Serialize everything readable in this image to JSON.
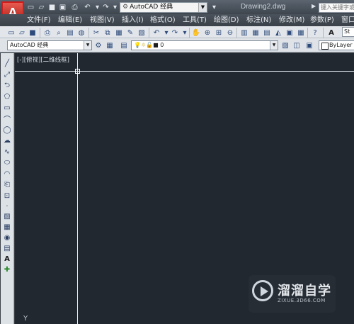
{
  "app": {
    "logo_letter": "A"
  },
  "title_bar": {
    "workspace": "AutoCAD 经典",
    "document_title": "Drawing2.dwg",
    "search_placeholder": "键入关键字或短语"
  },
  "menu": [
    {
      "label": "文件(F)"
    },
    {
      "label": "编辑(E)"
    },
    {
      "label": "视图(V)"
    },
    {
      "label": "插入(I)"
    },
    {
      "label": "格式(O)"
    },
    {
      "label": "工具(T)"
    },
    {
      "label": "绘图(D)"
    },
    {
      "label": "标注(N)"
    },
    {
      "label": "修改(M)"
    },
    {
      "label": "参数(P)"
    },
    {
      "label": "窗口"
    }
  ],
  "toolbar2": {
    "style_select": "AutoCAD 经典",
    "layer_value": "0",
    "color_value": "ByLayer"
  },
  "text_style_value": "St",
  "viewport": {
    "label": "[-][俯视][二维线框]"
  },
  "watermark": {
    "name": "溜溜自学",
    "url": "ZIXUE.3D66.COM"
  },
  "colors": {
    "canvas": "#212830",
    "app_button": "#c8251c",
    "crosshair": "#e8ecf0"
  }
}
